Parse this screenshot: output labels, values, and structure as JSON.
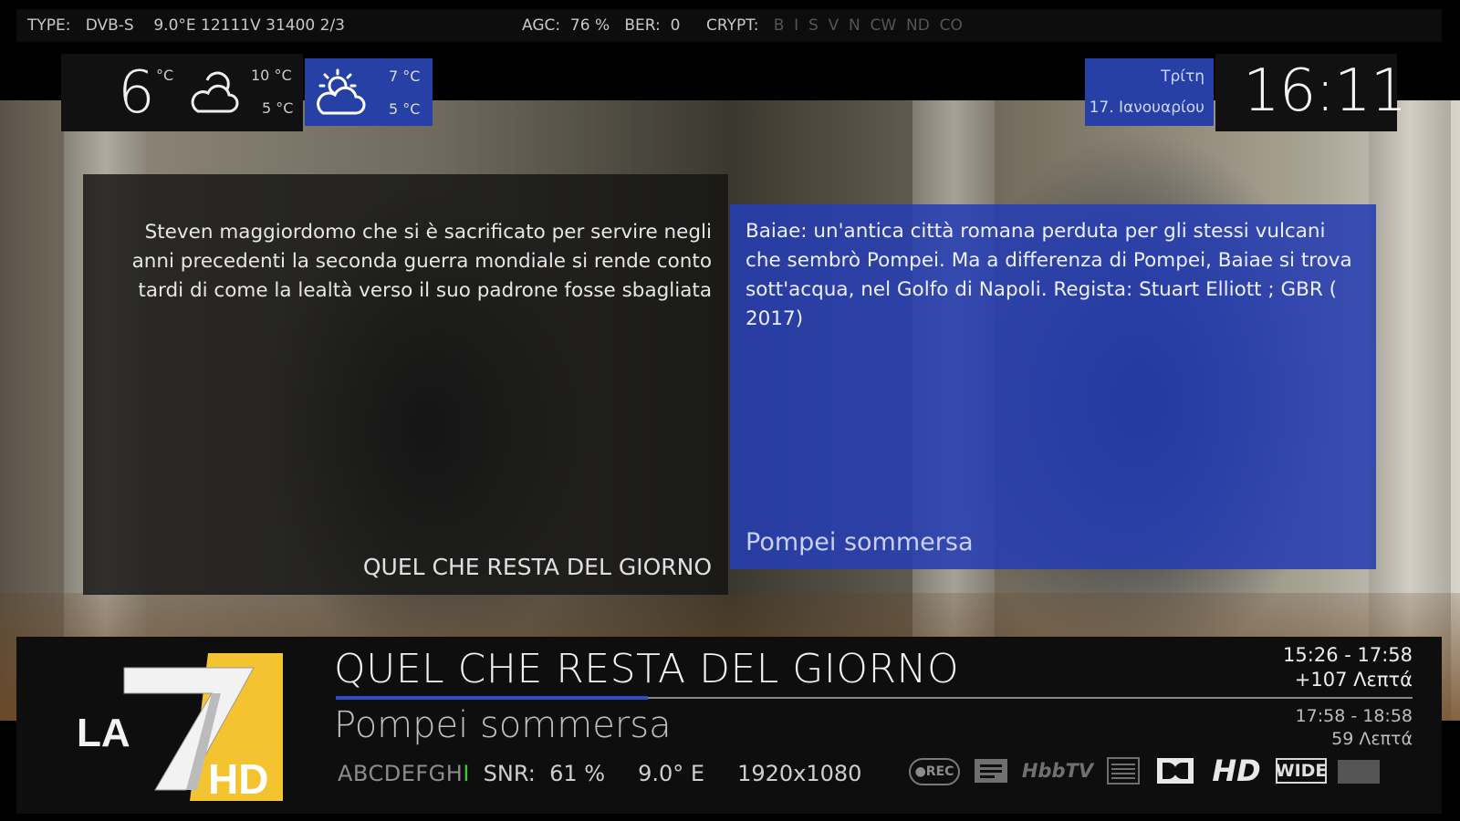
{
  "topbar": {
    "type_label": "TYPE:",
    "type_value": "DVB-S",
    "transponder": "9.0°E 12111V 31400 2/3",
    "agc_label": "AGC:",
    "agc_value": "76 %",
    "ber_label": "BER:",
    "ber_value": "0",
    "crypt_label": "CRYPT:",
    "crypt_systems": "B  I  S  V  N  CW  ND  CO"
  },
  "weather": {
    "current_temp": "6",
    "unit": "°C",
    "current_icon": "partly-cloudy-icon",
    "today_high": "10 °C",
    "today_low": "5 °C",
    "forecast_icon": "sun-cloud-icon",
    "forecast_high": "7 °C",
    "forecast_low": "5 °C"
  },
  "datetime": {
    "day": "Τρίτη",
    "date": "17. Ιανουαρίου",
    "time": "16:11"
  },
  "epg_left": {
    "description": "Steven maggiordomo che si è sacrificato per servire negli anni precedenti la seconda guerra mondiale si rende conto tardi di come la lealtà verso il suo padrone fosse sbagliata",
    "title": "QUEL CHE RESTA DEL GIORNO"
  },
  "epg_right": {
    "description": "Baiae: un'antica città romana perduta per gli stessi vulcani che sembrò Pompei. Ma a differenza di Pompei, Baiae si trova sott'acqua, nel Golfo di Napoli.  Regista: Stuart Elliott ; GBR  ( 2017)",
    "title": "Pompei sommersa"
  },
  "infobar": {
    "channel_logo_text": "LA 7 HD",
    "now_title": "QUEL CHE RESTA DEL GIORNO",
    "now_time": "15:26  -  17:58",
    "now_remaining": "+107 Λεπτά",
    "now_progress_percent": 29,
    "next_title": "Pompei sommersa",
    "next_time": "17:58  -  18:58",
    "next_duration": "59 Λεπτά",
    "ca_systems": "ABCDEFGH",
    "ca_active": "I",
    "snr_label": "SNR:",
    "snr_value": "61 %",
    "orbital": "9.0° E",
    "resolution": "1920x1080",
    "icons": {
      "rec": "REC",
      "hbbtv": "HbbTV",
      "hd": "HD",
      "wide": "WIDE"
    }
  },
  "colors": {
    "accent_blue": "#2740a6",
    "ca_active_green": "#2fd02f"
  }
}
